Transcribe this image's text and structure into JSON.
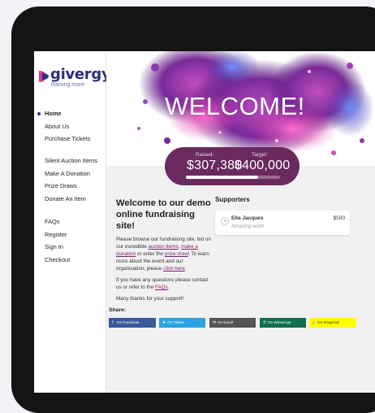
{
  "brand": {
    "name": "givergy",
    "tagline": "Raising more",
    "colors": {
      "navy": "#2b2f7a",
      "pink": "#d63c8f",
      "purple": "#6a2a5e",
      "link": "#7a1f6f"
    }
  },
  "sidebar": {
    "groups": [
      [
        {
          "label": "Home",
          "active": true
        },
        {
          "label": "About Us"
        },
        {
          "label": "Purchase Tickets"
        }
      ],
      [
        {
          "label": "Silent Auction Items"
        },
        {
          "label": "Make A Donation"
        },
        {
          "label": "Prize Draws"
        },
        {
          "label": "Donate An Item"
        }
      ],
      [
        {
          "label": "FAQs"
        },
        {
          "label": "Register"
        },
        {
          "label": "Sign In"
        },
        {
          "label": "Checkout"
        }
      ]
    ]
  },
  "hero": {
    "title": "WELCOME!",
    "raised_label": "Raised:",
    "raised_value": "$307,380",
    "target_label": "Target:",
    "target_value": "$400,000",
    "progress": 0.77
  },
  "content": {
    "heading": "Welcome to our demo online fundraising site!",
    "p1_a": "Please browse our fundraising site, bid on our incredible ",
    "p1_link1": "auction items",
    "p1_b": ", ",
    "p1_link2": "make a donation",
    "p1_c": " or enter the ",
    "p1_link3": "prize draw",
    "p1_d": "! To learn more about the event and our organisation, please ",
    "p1_link4": "click here",
    "p1_e": ".",
    "p2_a": "If you have any questions please contact us or refer to the ",
    "p2_link": "FAQs",
    "p2_b": ".",
    "p3": "Many thanks for your support!"
  },
  "share": {
    "label": "Share:",
    "buttons": [
      {
        "label": "On Facebook",
        "icon": "facebook-icon",
        "glyph": "f",
        "color": "#3b5998",
        "text_color": "#ffffff"
      },
      {
        "label": "On Twitter",
        "icon": "twitter-icon",
        "glyph": "❦",
        "color": "#2aa3e0",
        "text_color": "#ffffff"
      },
      {
        "label": "On Email",
        "icon": "email-icon",
        "glyph": "✉",
        "color": "#555555",
        "text_color": "#ffffff"
      },
      {
        "label": "On WhatsApp",
        "icon": "whatsapp-icon",
        "glyph": "✆",
        "color": "#0f6f50",
        "text_color": "#ffffff"
      },
      {
        "label": "On Snapchat",
        "icon": "snapchat-icon",
        "glyph": "⌂",
        "color": "#fffc00",
        "text_color": "#333333"
      }
    ]
  },
  "supporters": {
    "title": "Supporters",
    "items": [
      {
        "name": "Ella Jacques",
        "amount": "$500",
        "message": "Amazing work!"
      }
    ]
  }
}
